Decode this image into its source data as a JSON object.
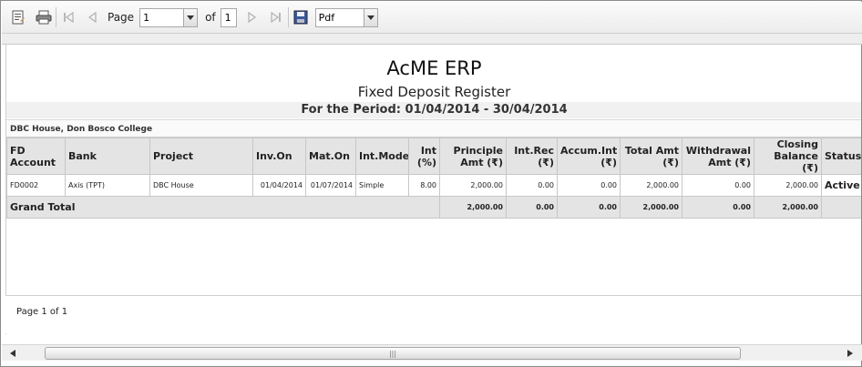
{
  "toolbar": {
    "page_label": "Page",
    "page_value": "1",
    "of_label": "of",
    "total_pages": "1",
    "export_format": "Pdf"
  },
  "report": {
    "company": "AcME ERP",
    "title": "Fixed Deposit Register",
    "period": "For the Period: 01/04/2014 - 30/04/2014",
    "branch": "DBC House, Don Bosco College",
    "columns": [
      "FD Account",
      "Bank",
      "Project",
      "Inv.On",
      "Mat.On",
      "Int.Mode",
      "Int (%)",
      "Principle Amt (₹)",
      "Int.Rec (₹)",
      "Accum.Int (₹)",
      "Total Amt (₹)",
      "Withdrawal Amt (₹)",
      "Closing Balance (₹)",
      "Status"
    ],
    "rows": [
      {
        "fd_account": "FD0002",
        "bank": "Axis (TPT)",
        "project": "DBC House",
        "inv_on": "01/04/2014",
        "mat_on": "01/07/2014",
        "int_mode": "Simple",
        "int_pct": "8.00",
        "principle": "2,000.00",
        "int_rec": "0.00",
        "accum_int": "0.00",
        "total_amt": "2,000.00",
        "withdrawal": "0.00",
        "closing": "2,000.00",
        "status": "Active"
      }
    ],
    "grand_total": {
      "label": "Grand Total",
      "principle": "2,000.00",
      "int_rec": "0.00",
      "accum_int": "0.00",
      "total_amt": "2,000.00",
      "withdrawal": "0.00",
      "closing": "2,000.00"
    },
    "footer": "Page 1 of 1"
  },
  "icons": {
    "toolbar": [
      "document-map-icon",
      "print-icon",
      "first-page-icon",
      "previous-page-icon",
      "next-page-icon",
      "last-page-icon",
      "save-icon"
    ],
    "scrollbar": [
      "scroll-left-icon",
      "scroll-right-icon"
    ]
  }
}
